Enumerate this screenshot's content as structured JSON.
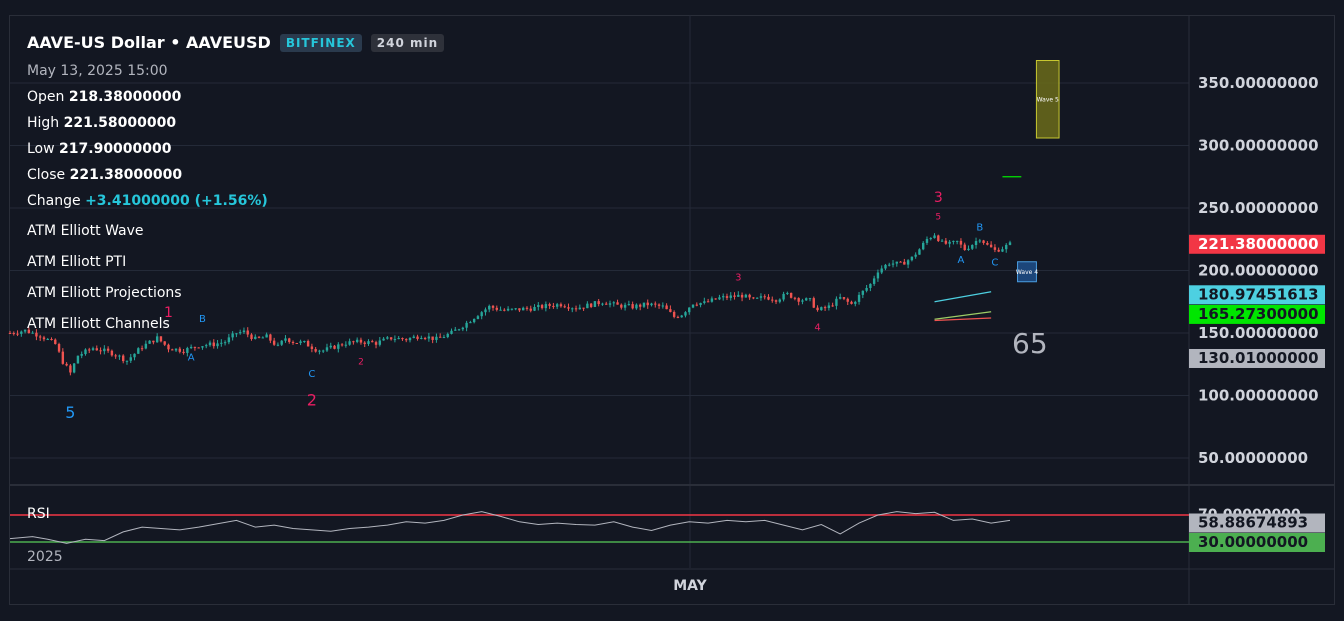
{
  "header": {
    "title": "AAVE-US Dollar • AAVEUSD",
    "exchange": "BITFINEX",
    "interval": "240 min",
    "date": "May 13, 2025",
    "time": "15:00"
  },
  "ohlc": {
    "open_label": "Open",
    "open": "218.38000000",
    "high_label": "High",
    "high": "221.58000000",
    "low_label": "Low",
    "low": "217.90000000",
    "close_label": "Close",
    "close": "221.38000000",
    "change_label": "Change",
    "change": "+3.41000000 (+1.56%)"
  },
  "indicators": [
    "ATM Elliott Wave",
    "ATM Elliott PTI",
    "ATM Elliott Projections",
    "ATM Elliott Channels"
  ],
  "rsi_label": "RSI",
  "big_number": "65",
  "time_axis": {
    "year": "2025",
    "month": "MAY"
  },
  "colors": {
    "background": "#131722",
    "grid": "#242a38",
    "up": "#26a69a",
    "down": "#ef5350",
    "wave_blue": "#2196f3",
    "wave_red": "#e91e63",
    "rsi_upper": "#f23645",
    "rsi_lower": "#4caf50",
    "rsi_line": "#b2b5be"
  },
  "chart_data": {
    "type": "candlestick",
    "y_ticks": [
      "350.00000000",
      "300.00000000",
      "250.00000000",
      "200.00000000",
      "150.00000000",
      "100.00000000",
      "50.00000000"
    ],
    "y_range": [
      0,
      380
    ],
    "price_badges": [
      {
        "value": "221.38000000",
        "price": 221.38,
        "color": "#f23645",
        "text_color": "#ffffff"
      },
      {
        "value": "180.97451613",
        "price": 180.97,
        "color": "#4dd0e1",
        "text_color": "#131722"
      },
      {
        "value": "165.27300000",
        "price": 165.27,
        "color": "#00e600",
        "text_color": "#131722"
      },
      {
        "value": "130.01000000",
        "price": 130.01,
        "color": "#b2b5be",
        "text_color": "#131722"
      }
    ],
    "price_path": [
      [
        0,
        150
      ],
      [
        4,
        152
      ],
      [
        8,
        148
      ],
      [
        12,
        141
      ],
      [
        14,
        127
      ],
      [
        16,
        118
      ],
      [
        18,
        132
      ],
      [
        22,
        138
      ],
      [
        27,
        134
      ],
      [
        31,
        128
      ],
      [
        35,
        139
      ],
      [
        39,
        146
      ],
      [
        42,
        138
      ],
      [
        46,
        136
      ],
      [
        50,
        140
      ],
      [
        54,
        141
      ],
      [
        57,
        143
      ],
      [
        60,
        150
      ],
      [
        62,
        151
      ],
      [
        65,
        145
      ],
      [
        68,
        147
      ],
      [
        71,
        139
      ],
      [
        73,
        146
      ],
      [
        75,
        143
      ],
      [
        78,
        142
      ],
      [
        81,
        137
      ],
      [
        83,
        136
      ],
      [
        86,
        139
      ],
      [
        89,
        142
      ],
      [
        93,
        143
      ],
      [
        97,
        142
      ],
      [
        101,
        146
      ],
      [
        105,
        145
      ],
      [
        109,
        148
      ],
      [
        113,
        145
      ],
      [
        117,
        150
      ],
      [
        121,
        158
      ],
      [
        124,
        165
      ],
      [
        127,
        171
      ],
      [
        131,
        168
      ],
      [
        135,
        169
      ],
      [
        139,
        170
      ],
      [
        143,
        172
      ],
      [
        146,
        173
      ],
      [
        150,
        170
      ],
      [
        153,
        172
      ],
      [
        157,
        175
      ],
      [
        161,
        172
      ],
      [
        165,
        171
      ],
      [
        169,
        173
      ],
      [
        173,
        171
      ],
      [
        176,
        163
      ],
      [
        178,
        165
      ],
      [
        181,
        174
      ],
      [
        184,
        174
      ],
      [
        188,
        178
      ],
      [
        191,
        179
      ],
      [
        194,
        180
      ],
      [
        197,
        176
      ],
      [
        200,
        179
      ],
      [
        203,
        177
      ],
      [
        206,
        181
      ],
      [
        209,
        177
      ],
      [
        212,
        176
      ],
      [
        214,
        168
      ],
      [
        217,
        171
      ],
      [
        220,
        178
      ],
      [
        223,
        173
      ],
      [
        226,
        183
      ],
      [
        228,
        189
      ],
      [
        230,
        200
      ],
      [
        233,
        206
      ],
      [
        236,
        205
      ],
      [
        239,
        210
      ],
      [
        241,
        217
      ],
      [
        243,
        225
      ],
      [
        245,
        229
      ],
      [
        247,
        222
      ],
      [
        249,
        221
      ],
      [
        251,
        223
      ],
      [
        253,
        217
      ],
      [
        255,
        221
      ],
      [
        257,
        226
      ],
      [
        259,
        220
      ],
      [
        261,
        216
      ],
      [
        263,
        218
      ],
      [
        265,
        221
      ]
    ],
    "rsi_upper": 70,
    "rsi_lower": 30,
    "rsi_ticks": [
      "70.00000000",
      "30.00000000"
    ],
    "rsi_badge": {
      "value": "58.88674893",
      "rsi": 58.89
    },
    "rsi_lower_badge": "30.00000000",
    "rsi_path": [
      [
        0,
        35
      ],
      [
        6,
        38
      ],
      [
        10,
        34
      ],
      [
        15,
        28
      ],
      [
        20,
        34
      ],
      [
        25,
        32
      ],
      [
        30,
        45
      ],
      [
        35,
        52
      ],
      [
        40,
        50
      ],
      [
        45,
        48
      ],
      [
        50,
        52
      ],
      [
        55,
        57
      ],
      [
        60,
        62
      ],
      [
        65,
        52
      ],
      [
        70,
        55
      ],
      [
        75,
        50
      ],
      [
        80,
        48
      ],
      [
        85,
        46
      ],
      [
        90,
        50
      ],
      [
        95,
        52
      ],
      [
        100,
        55
      ],
      [
        105,
        60
      ],
      [
        110,
        58
      ],
      [
        115,
        62
      ],
      [
        120,
        70
      ],
      [
        125,
        75
      ],
      [
        130,
        68
      ],
      [
        135,
        60
      ],
      [
        140,
        56
      ],
      [
        145,
        58
      ],
      [
        150,
        56
      ],
      [
        155,
        55
      ],
      [
        160,
        60
      ],
      [
        165,
        52
      ],
      [
        170,
        47
      ],
      [
        175,
        55
      ],
      [
        180,
        60
      ],
      [
        185,
        58
      ],
      [
        190,
        62
      ],
      [
        195,
        60
      ],
      [
        200,
        62
      ],
      [
        205,
        55
      ],
      [
        210,
        48
      ],
      [
        215,
        56
      ],
      [
        220,
        42
      ],
      [
        225,
        58
      ],
      [
        230,
        70
      ],
      [
        235,
        75
      ],
      [
        240,
        72
      ],
      [
        245,
        74
      ],
      [
        250,
        62
      ],
      [
        255,
        64
      ],
      [
        260,
        58
      ],
      [
        265,
        62
      ]
    ],
    "wave_labels": [
      {
        "text": "5",
        "i": 16,
        "price": 82,
        "color": "#2196f3",
        "size": 16
      },
      {
        "text": "1",
        "i": 42,
        "price": 163,
        "color": "#e91e63",
        "size": 14
      },
      {
        "text": "A",
        "i": 48,
        "price": 128,
        "color": "#2196f3",
        "size": 10
      },
      {
        "text": "B",
        "i": 51,
        "price": 159,
        "color": "#2196f3",
        "size": 10
      },
      {
        "text": "C",
        "i": 80,
        "price": 115,
        "color": "#2196f3",
        "size": 10
      },
      {
        "text": "2",
        "i": 80,
        "price": 92,
        "color": "#e91e63",
        "size": 16
      },
      {
        "text": "2",
        "i": 93,
        "price": 125,
        "color": "#e91e63",
        "size": 9
      },
      {
        "text": "3",
        "i": 193,
        "price": 192,
        "color": "#e91e63",
        "size": 10
      },
      {
        "text": "4",
        "i": 214,
        "price": 152,
        "color": "#e91e63",
        "size": 10
      },
      {
        "text": "3",
        "i": 246,
        "price": 255,
        "color": "#e91e63",
        "size": 14
      },
      {
        "text": "5",
        "i": 246,
        "price": 241,
        "color": "#e91e63",
        "size": 9
      },
      {
        "text": "A",
        "i": 252,
        "price": 206,
        "color": "#2196f3",
        "size": 10
      },
      {
        "text": "B",
        "i": 257,
        "price": 232,
        "color": "#2196f3",
        "size": 10
      },
      {
        "text": "C",
        "i": 261,
        "price": 204,
        "color": "#2196f3",
        "size": 10
      }
    ],
    "projection_boxes": [
      {
        "label": "Wave 5",
        "i0": 272,
        "i1": 278,
        "top": 368,
        "bottom": 306,
        "fill": "#6b6b1a",
        "stroke": "#c8c830",
        "text_color": "#ffffff"
      },
      {
        "label": "Wave 4",
        "i0": 267,
        "i1": 272,
        "top": 207,
        "bottom": 191,
        "fill": "#1f4f8a",
        "stroke": "#4a9de0",
        "text_color": "#ffffff"
      }
    ],
    "projection_lines": [
      {
        "i0": 245,
        "p0": 175,
        "i1": 260,
        "p1": 183,
        "color": "#4dd0e1"
      },
      {
        "i0": 245,
        "p0": 161,
        "i1": 260,
        "p1": 167,
        "color": "#9ccc65"
      },
      {
        "i0": 245,
        "p0": 160,
        "i1": 260,
        "p1": 162,
        "color": "#ef5350"
      },
      {
        "i0": 263,
        "p0": 275,
        "i1": 268,
        "p1": 275,
        "color": "#00e600"
      }
    ]
  }
}
